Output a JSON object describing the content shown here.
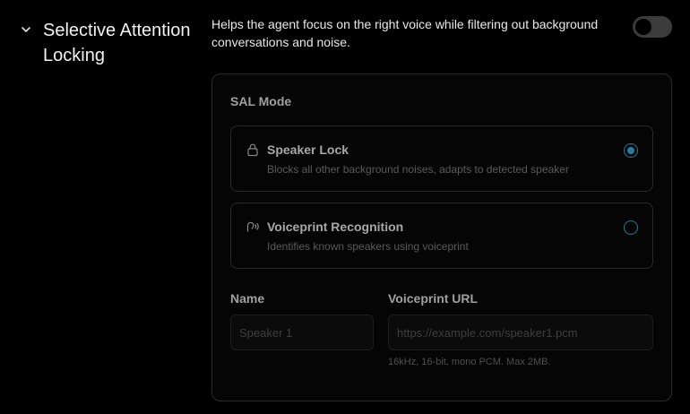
{
  "section": {
    "title": "Selective Attention Locking",
    "description": "Helps the agent focus on the right voice while filtering out background conversations and noise.",
    "enabled": false
  },
  "panel": {
    "mode_label": "SAL Mode",
    "options": [
      {
        "icon": "lock-icon",
        "title": "Speaker Lock",
        "description": "Blocks all other background noises, adapts to detected speaker",
        "selected": true
      },
      {
        "icon": "voiceprint-icon",
        "title": "Voiceprint Recognition",
        "description": "Identifies known speakers using voiceprint",
        "selected": false
      }
    ],
    "name_field": {
      "label": "Name",
      "placeholder": "Speaker 1",
      "value": ""
    },
    "url_field": {
      "label": "Voiceprint URL",
      "placeholder": "https://example.com/speaker1.pcm",
      "value": "",
      "hint": "16kHz, 16-bit, mono PCM. Max 2MB."
    }
  },
  "colors": {
    "accent": "#1d7fa3",
    "background": "#000000",
    "border": "#2a2a2a"
  }
}
